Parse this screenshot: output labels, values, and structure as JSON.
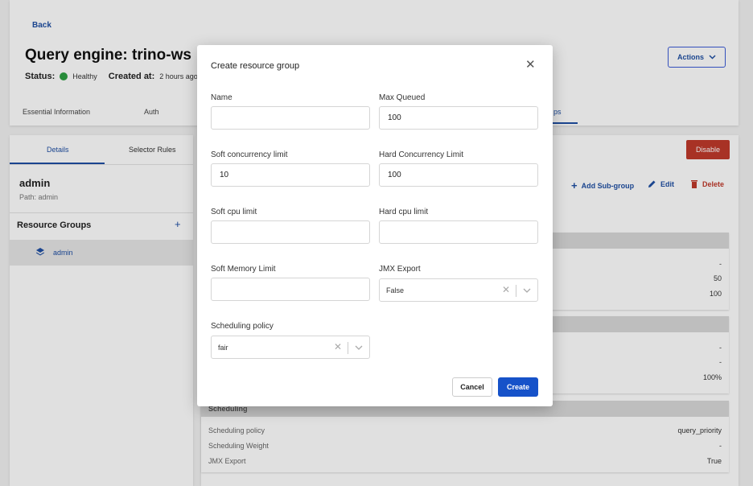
{
  "header": {
    "back_label": "Back",
    "title": "Query engine: trino-ws",
    "status_label": "Status:",
    "status_value": "Healthy",
    "created_label": "Created at:",
    "created_value": "2 hours ago",
    "actions_label": "Actions"
  },
  "tabs": [
    {
      "label": "Essential Information"
    },
    {
      "label": "Auth"
    },
    {
      "label": "ps"
    }
  ],
  "left_panel": {
    "subtabs": [
      {
        "label": "Details"
      },
      {
        "label": "Selector Rules"
      }
    ],
    "group_name": "admin",
    "group_path": "Path: admin",
    "resource_groups_title": "Resource Groups",
    "add_symbol": "+",
    "tree_item": "admin"
  },
  "right_panel": {
    "disable_label": "Disable",
    "add_subgroup_label": "Add Sub-group",
    "edit_label": "Edit",
    "delete_label": "Delete",
    "section1_values": [
      "-",
      "50",
      "100"
    ],
    "section2_values": [
      "-",
      "-",
      "100%"
    ],
    "scheduling_section": {
      "title": "Scheduling",
      "rows": [
        {
          "label": "Scheduling policy",
          "value": "query_priority"
        },
        {
          "label": "Scheduling Weight",
          "value": "-"
        },
        {
          "label": "JMX Export",
          "value": "True"
        }
      ]
    }
  },
  "modal": {
    "title": "Create resource group",
    "close_symbol": "✕",
    "fields": {
      "name": {
        "label": "Name",
        "value": ""
      },
      "max_queued": {
        "label": "Max Queued",
        "value": "100"
      },
      "soft_concurrency": {
        "label": "Soft concurrency limit",
        "value": "10"
      },
      "hard_concurrency": {
        "label": "Hard Concurrency Limit",
        "value": "100"
      },
      "soft_cpu": {
        "label": "Soft cpu limit",
        "value": ""
      },
      "hard_cpu": {
        "label": "Hard cpu limit",
        "value": ""
      },
      "soft_memory": {
        "label": "Soft Memory Limit",
        "value": ""
      },
      "jmx_export": {
        "label": "JMX Export",
        "value": "False"
      },
      "scheduling_policy": {
        "label": "Scheduling policy",
        "value": "fair"
      }
    },
    "clear_symbol": "✕",
    "cancel_label": "Cancel",
    "create_label": "Create"
  },
  "colors": {
    "primary": "#1652c9",
    "danger": "#c0392b",
    "healthy": "#2ea043"
  }
}
